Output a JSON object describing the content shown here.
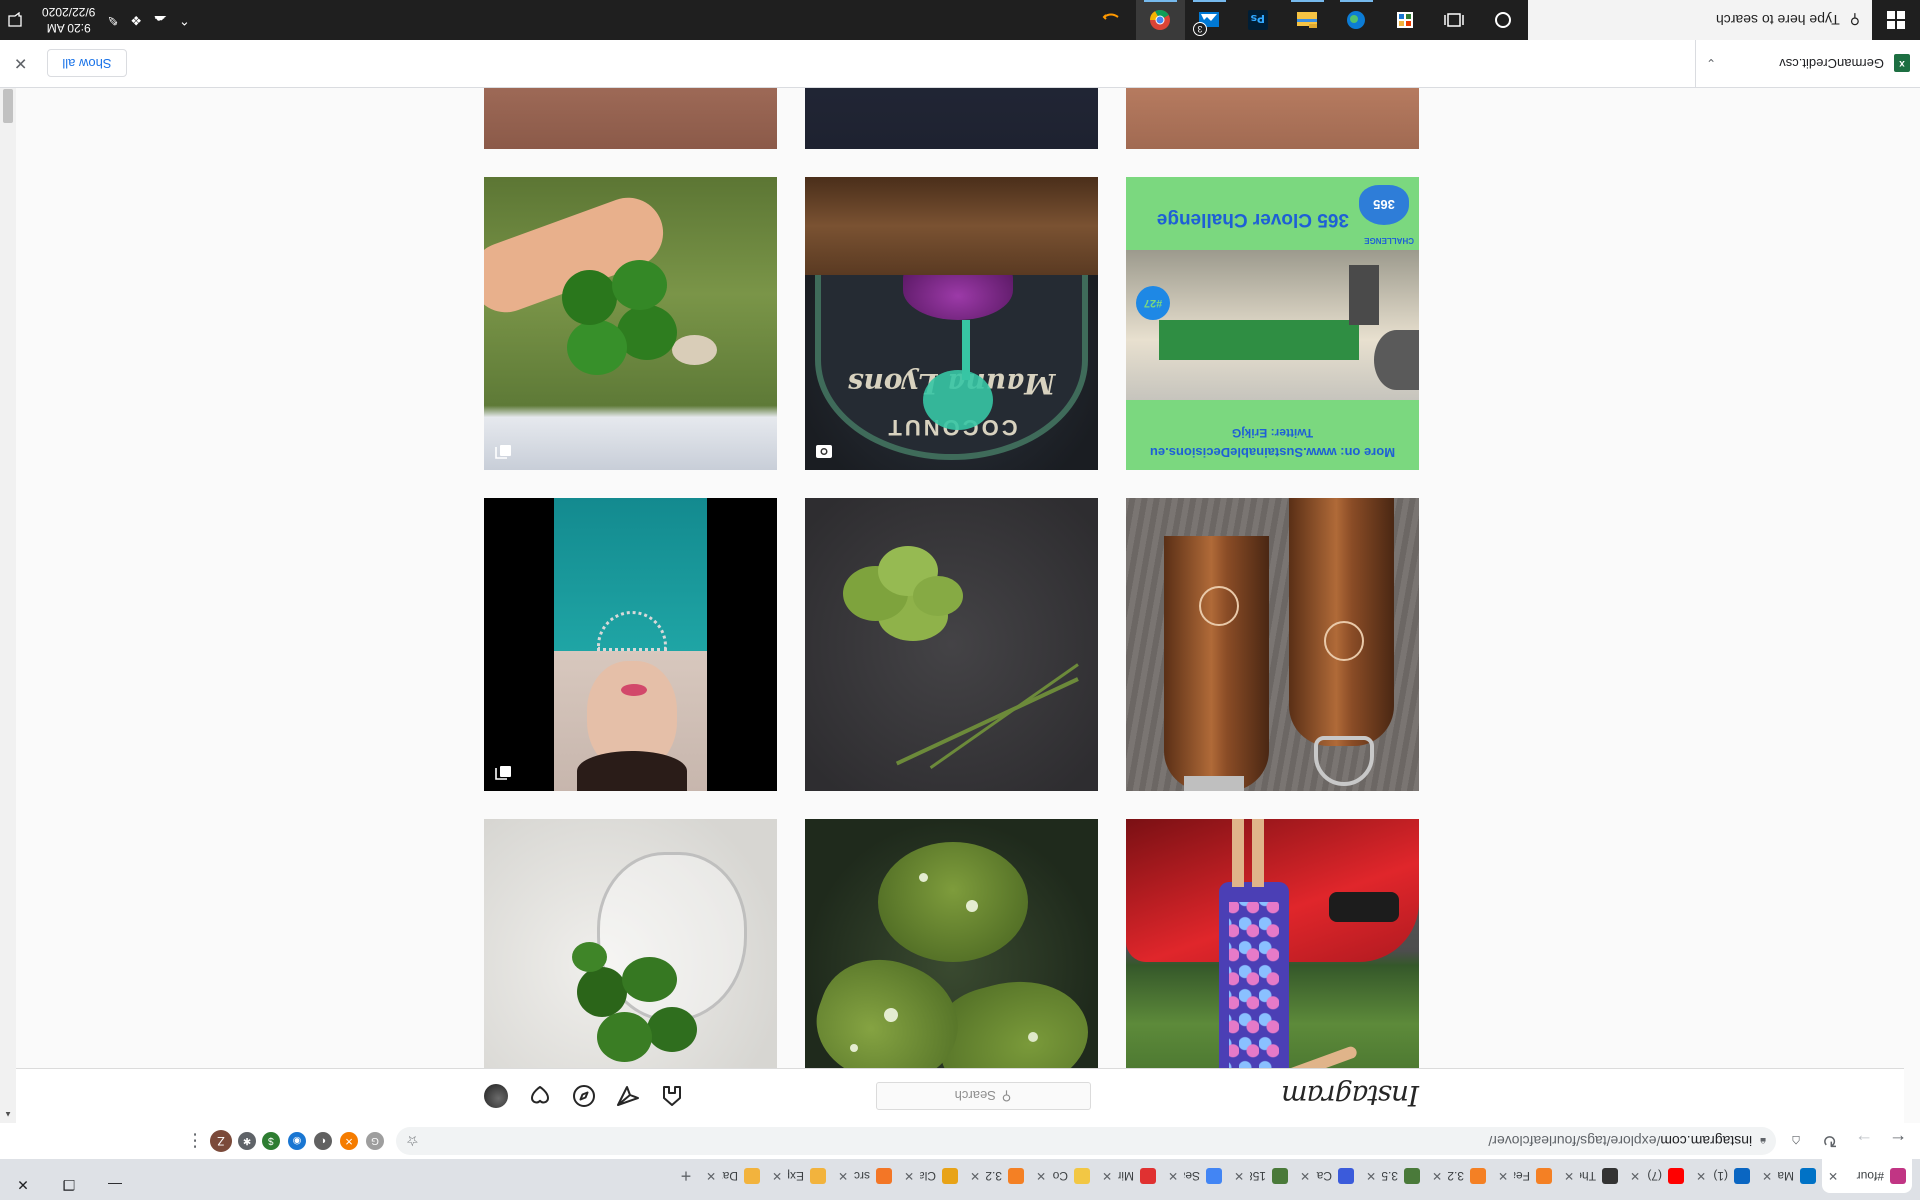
{
  "browser": {
    "tabs": [
      {
        "label": "#four",
        "color": "#c13584",
        "active": true
      },
      {
        "label": "Mail",
        "color": "#0072c6"
      },
      {
        "label": "(1) Li",
        "color": "#0a66c2"
      },
      {
        "label": "(7) Su",
        "color": "#ff0000"
      },
      {
        "label": "The I",
        "color": "#333333"
      },
      {
        "label": "Featu",
        "color": "#f48024"
      },
      {
        "label": "3.2.4",
        "color": "#f48024"
      },
      {
        "label": "3.5 C",
        "color": "#4a7a3a"
      },
      {
        "label": "Caps",
        "color": "#3b5bdb"
      },
      {
        "label": "1585",
        "color": "#4a7a3a"
      },
      {
        "label": "Searc",
        "color": "#4285f4"
      },
      {
        "label": "Mini-",
        "color": "#e03131"
      },
      {
        "label": "Copy",
        "color": "#f2c744"
      },
      {
        "label": "3.2.4",
        "color": "#f48024"
      },
      {
        "label": "Class",
        "color": "#e8a317"
      },
      {
        "label": "src/c",
        "color": "#f37626"
      },
      {
        "label": "Expe",
        "color": "#f2b33d"
      },
      {
        "label": "Data",
        "color": "#f2b33d"
      }
    ],
    "url_host": "instagram.com",
    "url_path": "/explore/tags/fourleafclover/",
    "profile_initial": "Z",
    "extensions": [
      {
        "name": "shield-extension-icon",
        "color": "#9e9e9e",
        "glyph": "G"
      },
      {
        "name": "ext-orange-icon",
        "color": "#f57c00",
        "glyph": "✕"
      },
      {
        "name": "ext-circle-icon",
        "color": "#616161",
        "glyph": "◐"
      },
      {
        "name": "ext-blue-icon",
        "color": "#1976d2",
        "glyph": "◉"
      },
      {
        "name": "ext-money-icon",
        "color": "#2e7d32",
        "glyph": "$"
      }
    ]
  },
  "instagram": {
    "logo": "Instagram",
    "search_placeholder": "Search"
  },
  "posts": [
    {
      "kind": "woman-car"
    },
    {
      "kind": "clover-drops"
    },
    {
      "kind": "clover-glass"
    },
    {
      "kind": "bottles"
    },
    {
      "kind": "dark-clover"
    },
    {
      "kind": "woman-teal",
      "badge": "carousel"
    },
    {
      "kind": "challenge",
      "title": "365 Clover Challenge",
      "subtitle": "CHALLENGE",
      "badge_text": "365",
      "number": "#27",
      "line1": "More on: www.SustainableDecisions.eu",
      "line2": "Twitter: ErikjG"
    },
    {
      "kind": "coconut",
      "sign": "COCONUT",
      "script": "Mauna Lyons",
      "badge": "video"
    },
    {
      "kind": "hand-clover",
      "badge": "carousel"
    },
    {
      "kind": "partial-skin"
    },
    {
      "kind": "partial-dark"
    },
    {
      "kind": "partial-hand"
    }
  ],
  "download": {
    "filename": "GermanCredit.csv",
    "show_all": "Show all"
  },
  "taskbar": {
    "search_placeholder": "Type here to search",
    "time": "9:20 AM",
    "date": "9/22/2020",
    "onedrive_badge": "3"
  }
}
